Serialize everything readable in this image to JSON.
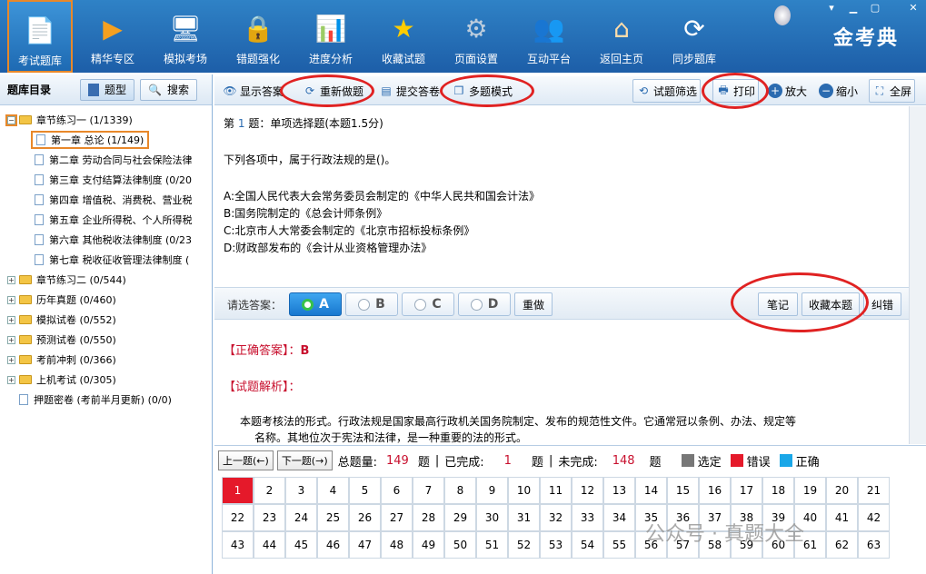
{
  "nav": [
    "考试题库",
    "精华专区",
    "模拟考场",
    "错题强化",
    "进度分析",
    "收藏试题",
    "页面设置",
    "互动平台",
    "返回主页",
    "同步题库"
  ],
  "logo": "金考典",
  "left": {
    "title": "题库目录",
    "btn_type": "题型",
    "btn_search": "搜索"
  },
  "tree": [
    {
      "label": "章节练习一 (1/1339)",
      "lvl": 0,
      "kind": "folder",
      "tog": "−"
    },
    {
      "label": "第一章 总论 (1/149)",
      "lvl": 1,
      "kind": "doc"
    },
    {
      "label": "第二章 劳动合同与社会保险法律",
      "lvl": 1,
      "kind": "doc"
    },
    {
      "label": "第三章 支付结算法律制度 (0/20",
      "lvl": 1,
      "kind": "doc"
    },
    {
      "label": "第四章 增值税、消费税、营业税",
      "lvl": 1,
      "kind": "doc"
    },
    {
      "label": "第五章 企业所得税、个人所得税",
      "lvl": 1,
      "kind": "doc"
    },
    {
      "label": "第六章 其他税收法律制度 (0/23",
      "lvl": 1,
      "kind": "doc"
    },
    {
      "label": "第七章 税收征收管理法律制度 (",
      "lvl": 1,
      "kind": "doc"
    },
    {
      "label": "章节练习二 (0/544)",
      "lvl": 0,
      "kind": "folder",
      "tog": "+"
    },
    {
      "label": "历年真题 (0/460)",
      "lvl": 0,
      "kind": "folder",
      "tog": "+"
    },
    {
      "label": "模拟试卷 (0/552)",
      "lvl": 0,
      "kind": "folder",
      "tog": "+"
    },
    {
      "label": "预测试卷 (0/550)",
      "lvl": 0,
      "kind": "folder",
      "tog": "+"
    },
    {
      "label": "考前冲刺 (0/366)",
      "lvl": 0,
      "kind": "folder",
      "tog": "+"
    },
    {
      "label": "上机考试 (0/305)",
      "lvl": 0,
      "kind": "folder",
      "tog": "+"
    },
    {
      "label": "押题密卷 (考前半月更新) (0/0)",
      "lvl": 0,
      "kind": "doc"
    }
  ],
  "toolbar": {
    "show": "显示答案",
    "redo": "重新做题",
    "submit": "提交答卷",
    "multi": "多题模式",
    "filter": "试题筛选",
    "print": "打印",
    "zoomin": "放大",
    "zoomout": "缩小",
    "full": "全屏"
  },
  "question": {
    "num_prefix": "第",
    "num": "1",
    "num_suffix": "题：单项选择题(本题1.5分)",
    "stem": "下列各项中，属于行政法规的是()。",
    "options": [
      "A:全国人民代表大会常务委员会制定的《中华人民共和国会计法》",
      "B:国务院制定的《总会计师条例》",
      "C:北京市人大常委会制定的《北京市招标投标条例》",
      "D:财政部发布的《会计从业资格管理办法》"
    ]
  },
  "answer": {
    "prompt": "请选答案：",
    "opts": [
      "A",
      "B",
      "C",
      "D"
    ],
    "redo": "重做",
    "note": "笔记",
    "fav": "收藏本题",
    "error": "纠错"
  },
  "analysis": {
    "correct_label": "【正确答案】：",
    "correct": "B",
    "exp_label": "【试题解析】：",
    "text1": "本题考核法的形式。行政法规是国家最高行政机关国务院制定、发布的规范性文件。它通常冠以条例、办法、规定等",
    "text2": "名称。其地位次于宪法和法律，是一种重要的法的形式。"
  },
  "status": {
    "prev": "上一题(←)",
    "next": "下一题(→)",
    "total_label": "总题量:",
    "total": "149",
    "unit": "题",
    "done_label": "已完成:",
    "done": "1",
    "undone_label": "未完成:",
    "undone": "148",
    "legend_sel": "选定",
    "legend_err": "错误",
    "legend_ok": "正确"
  },
  "grid": [
    "1",
    "2",
    "3",
    "4",
    "5",
    "6",
    "7",
    "8",
    "9",
    "10",
    "11",
    "12",
    "13",
    "14",
    "15",
    "16",
    "17",
    "18",
    "19",
    "20",
    "21",
    "22",
    "23",
    "24",
    "25",
    "26",
    "27",
    "28",
    "29",
    "30",
    "31",
    "32",
    "33",
    "34",
    "35",
    "36",
    "37",
    "38",
    "39",
    "40",
    "41",
    "42",
    "43",
    "44",
    "45",
    "46",
    "47",
    "48",
    "49",
    "50",
    "51",
    "52",
    "53",
    "54",
    "55",
    "56",
    "57",
    "58",
    "59",
    "60",
    "61",
    "62",
    "63"
  ],
  "watermark": "公众号 · 真题大全",
  "colors": {
    "selected": "#777777",
    "error": "#e5192a",
    "correct": "#1aa7e8",
    "accent": "#1d5ea8"
  }
}
